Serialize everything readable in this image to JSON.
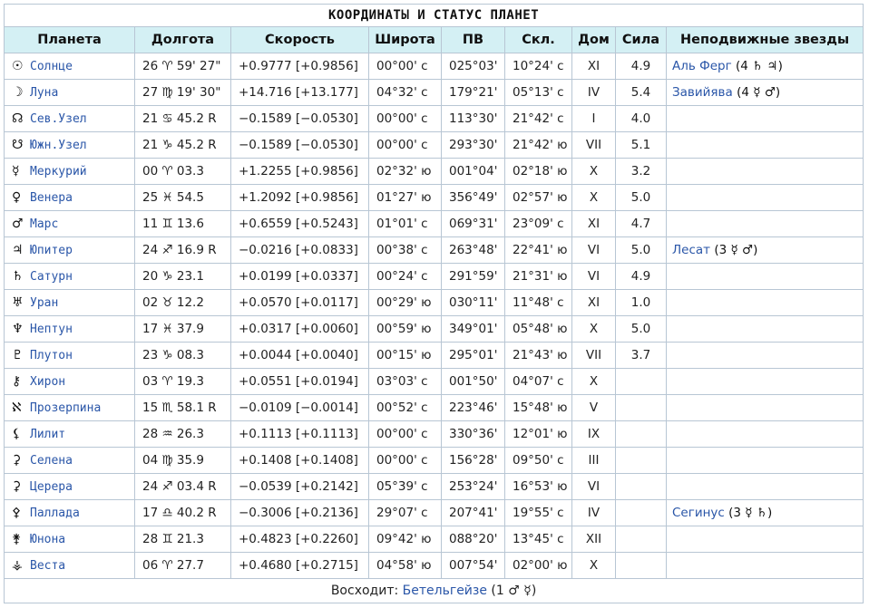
{
  "title": "КООРДИНАТЫ И СТАТУС ПЛАНЕТ",
  "columns": [
    "Планета",
    "Долгота",
    "Скорость",
    "Широта",
    "ПВ",
    "Скл.",
    "Дом",
    "Сила",
    "Неподвижные звезды"
  ],
  "rows": [
    {
      "glyph": "☉",
      "planet": "Солнце",
      "longitude": "26 ♈ 59' 27\"",
      "speed": "+0.9777  [+0.9856]",
      "latitude": "00°00' с",
      "ra": "025°03'",
      "decl": "10°24' с",
      "house": "XI",
      "strength": "4.9",
      "star": "Аль Ферг",
      "star_info": "(4 ♄ ♃)"
    },
    {
      "glyph": "☽",
      "planet": "Луна",
      "longitude": "27 ♍ 19' 30\"",
      "speed": "+14.716  [+13.177]",
      "latitude": "04°32' с",
      "ra": "179°21'",
      "decl": "05°13' с",
      "house": "IV",
      "strength": "5.4",
      "star": "Завийява",
      "star_info": "(4 ☿ ♂)"
    },
    {
      "glyph": "☊",
      "planet": "Сев.Узел",
      "longitude": "21 ♋ 45.2  R",
      "speed": "−0.1589  [−0.0530]",
      "latitude": "00°00' с",
      "ra": "113°30'",
      "decl": "21°42' с",
      "house": "I",
      "strength": "4.0",
      "star": "",
      "star_info": ""
    },
    {
      "glyph": "☋",
      "planet": "Южн.Узел",
      "longitude": "21 ♑ 45.2  R",
      "speed": "−0.1589  [−0.0530]",
      "latitude": "00°00' с",
      "ra": "293°30'",
      "decl": "21°42' ю",
      "house": "VII",
      "strength": "5.1",
      "star": "",
      "star_info": ""
    },
    {
      "glyph": "☿",
      "planet": "Меркурий",
      "longitude": "00 ♈ 03.3",
      "speed": "+1.2255  [+0.9856]",
      "latitude": "02°32' ю",
      "ra": "001°04'",
      "decl": "02°18' ю",
      "house": "X",
      "strength": "3.2",
      "star": "",
      "star_info": ""
    },
    {
      "glyph": "♀",
      "planet": "Венера",
      "longitude": "25 ♓ 54.5",
      "speed": "+1.2092  [+0.9856]",
      "latitude": "01°27' ю",
      "ra": "356°49'",
      "decl": "02°57' ю",
      "house": "X",
      "strength": "5.0",
      "star": "",
      "star_info": ""
    },
    {
      "glyph": "♂",
      "planet": "Марс",
      "longitude": "11 ♊ 13.6",
      "speed": "+0.6559  [+0.5243]",
      "latitude": "01°01' с",
      "ra": "069°31'",
      "decl": "23°09' с",
      "house": "XI",
      "strength": "4.7",
      "star": "",
      "star_info": ""
    },
    {
      "glyph": "♃",
      "planet": "Юпитер",
      "longitude": "24 ♐ 16.9  R",
      "speed": "−0.0216  [+0.0833]",
      "latitude": "00°38' с",
      "ra": "263°48'",
      "decl": "22°41' ю",
      "house": "VI",
      "strength": "5.0",
      "star": "Лесат",
      "star_info": "(3 ☿ ♂)"
    },
    {
      "glyph": "♄",
      "planet": "Сатурн",
      "longitude": "20 ♑ 23.1",
      "speed": "+0.0199  [+0.0337]",
      "latitude": "00°24' с",
      "ra": "291°59'",
      "decl": "21°31' ю",
      "house": "VI",
      "strength": "4.9",
      "star": "",
      "star_info": ""
    },
    {
      "glyph": "♅",
      "planet": "Уран",
      "longitude": "02 ♉ 12.2",
      "speed": "+0.0570  [+0.0117]",
      "latitude": "00°29' ю",
      "ra": "030°11'",
      "decl": "11°48' с",
      "house": "XI",
      "strength": "1.0",
      "star": "",
      "star_info": ""
    },
    {
      "glyph": "♆",
      "planet": "Нептун",
      "longitude": "17 ♓ 37.9",
      "speed": "+0.0317  [+0.0060]",
      "latitude": "00°59' ю",
      "ra": "349°01'",
      "decl": "05°48' ю",
      "house": "X",
      "strength": "5.0",
      "star": "",
      "star_info": ""
    },
    {
      "glyph": "♇",
      "planet": "Плутон",
      "longitude": "23 ♑ 08.3",
      "speed": "+0.0044  [+0.0040]",
      "latitude": "00°15' ю",
      "ra": "295°01'",
      "decl": "21°43' ю",
      "house": "VII",
      "strength": "3.7",
      "star": "",
      "star_info": ""
    },
    {
      "glyph": "⚷",
      "planet": "Хирон",
      "longitude": "03 ♈ 19.3",
      "speed": "+0.0551  [+0.0194]",
      "latitude": "03°03' с",
      "ra": "001°50'",
      "decl": "04°07' с",
      "house": "X",
      "strength": "",
      "star": "",
      "star_info": ""
    },
    {
      "glyph": "ℵ",
      "planet": "Прозерпина",
      "longitude": "15 ♏ 58.1  R",
      "speed": "−0.0109  [−0.0014]",
      "latitude": "00°52' с",
      "ra": "223°46'",
      "decl": "15°48' ю",
      "house": "V",
      "strength": "",
      "star": "",
      "star_info": ""
    },
    {
      "glyph": "⚸",
      "planet": "Лилит",
      "longitude": "28 ♒ 26.3",
      "speed": "+0.1113  [+0.1113]",
      "latitude": "00°00' с",
      "ra": "330°36'",
      "decl": "12°01' ю",
      "house": "IX",
      "strength": "",
      "star": "",
      "star_info": ""
    },
    {
      "glyph": "⚳",
      "planet": "Селена",
      "longitude": "04 ♍ 35.9",
      "speed": "+0.1408  [+0.1408]",
      "latitude": "00°00' с",
      "ra": "156°28'",
      "decl": "09°50' с",
      "house": "III",
      "strength": "",
      "star": "",
      "star_info": ""
    },
    {
      "glyph": "⚳",
      "planet": "Церера",
      "longitude": "24 ♐ 03.4  R",
      "speed": "−0.0539  [+0.2142]",
      "latitude": "05°39' с",
      "ra": "253°24'",
      "decl": "16°53' ю",
      "house": "VI",
      "strength": "",
      "star": "",
      "star_info": ""
    },
    {
      "glyph": "⚴",
      "planet": "Паллада",
      "longitude": "17 ♎ 40.2  R",
      "speed": "−0.3006  [+0.2136]",
      "latitude": "29°07' с",
      "ra": "207°41'",
      "decl": "19°55' с",
      "house": "IV",
      "strength": "",
      "star": "Сегинус",
      "star_info": "(3 ☿ ♄)"
    },
    {
      "glyph": "⚵",
      "planet": "Юнона",
      "longitude": "28 ♊ 21.3",
      "speed": "+0.4823  [+0.2260]",
      "latitude": "09°42' ю",
      "ra": "088°20'",
      "decl": "13°45' с",
      "house": "XII",
      "strength": "",
      "star": "",
      "star_info": ""
    },
    {
      "glyph": "⚶",
      "planet": "Веста",
      "longitude": "06 ♈ 27.7",
      "speed": "+0.4680  [+0.2715]",
      "latitude": "04°58' ю",
      "ra": "007°54'",
      "decl": "02°00' ю",
      "house": "X",
      "strength": "",
      "star": "",
      "star_info": ""
    }
  ],
  "footer": {
    "prefix": "Восходит:",
    "star": "Бетельгейзе",
    "info": "(1 ♂ ☿)"
  }
}
